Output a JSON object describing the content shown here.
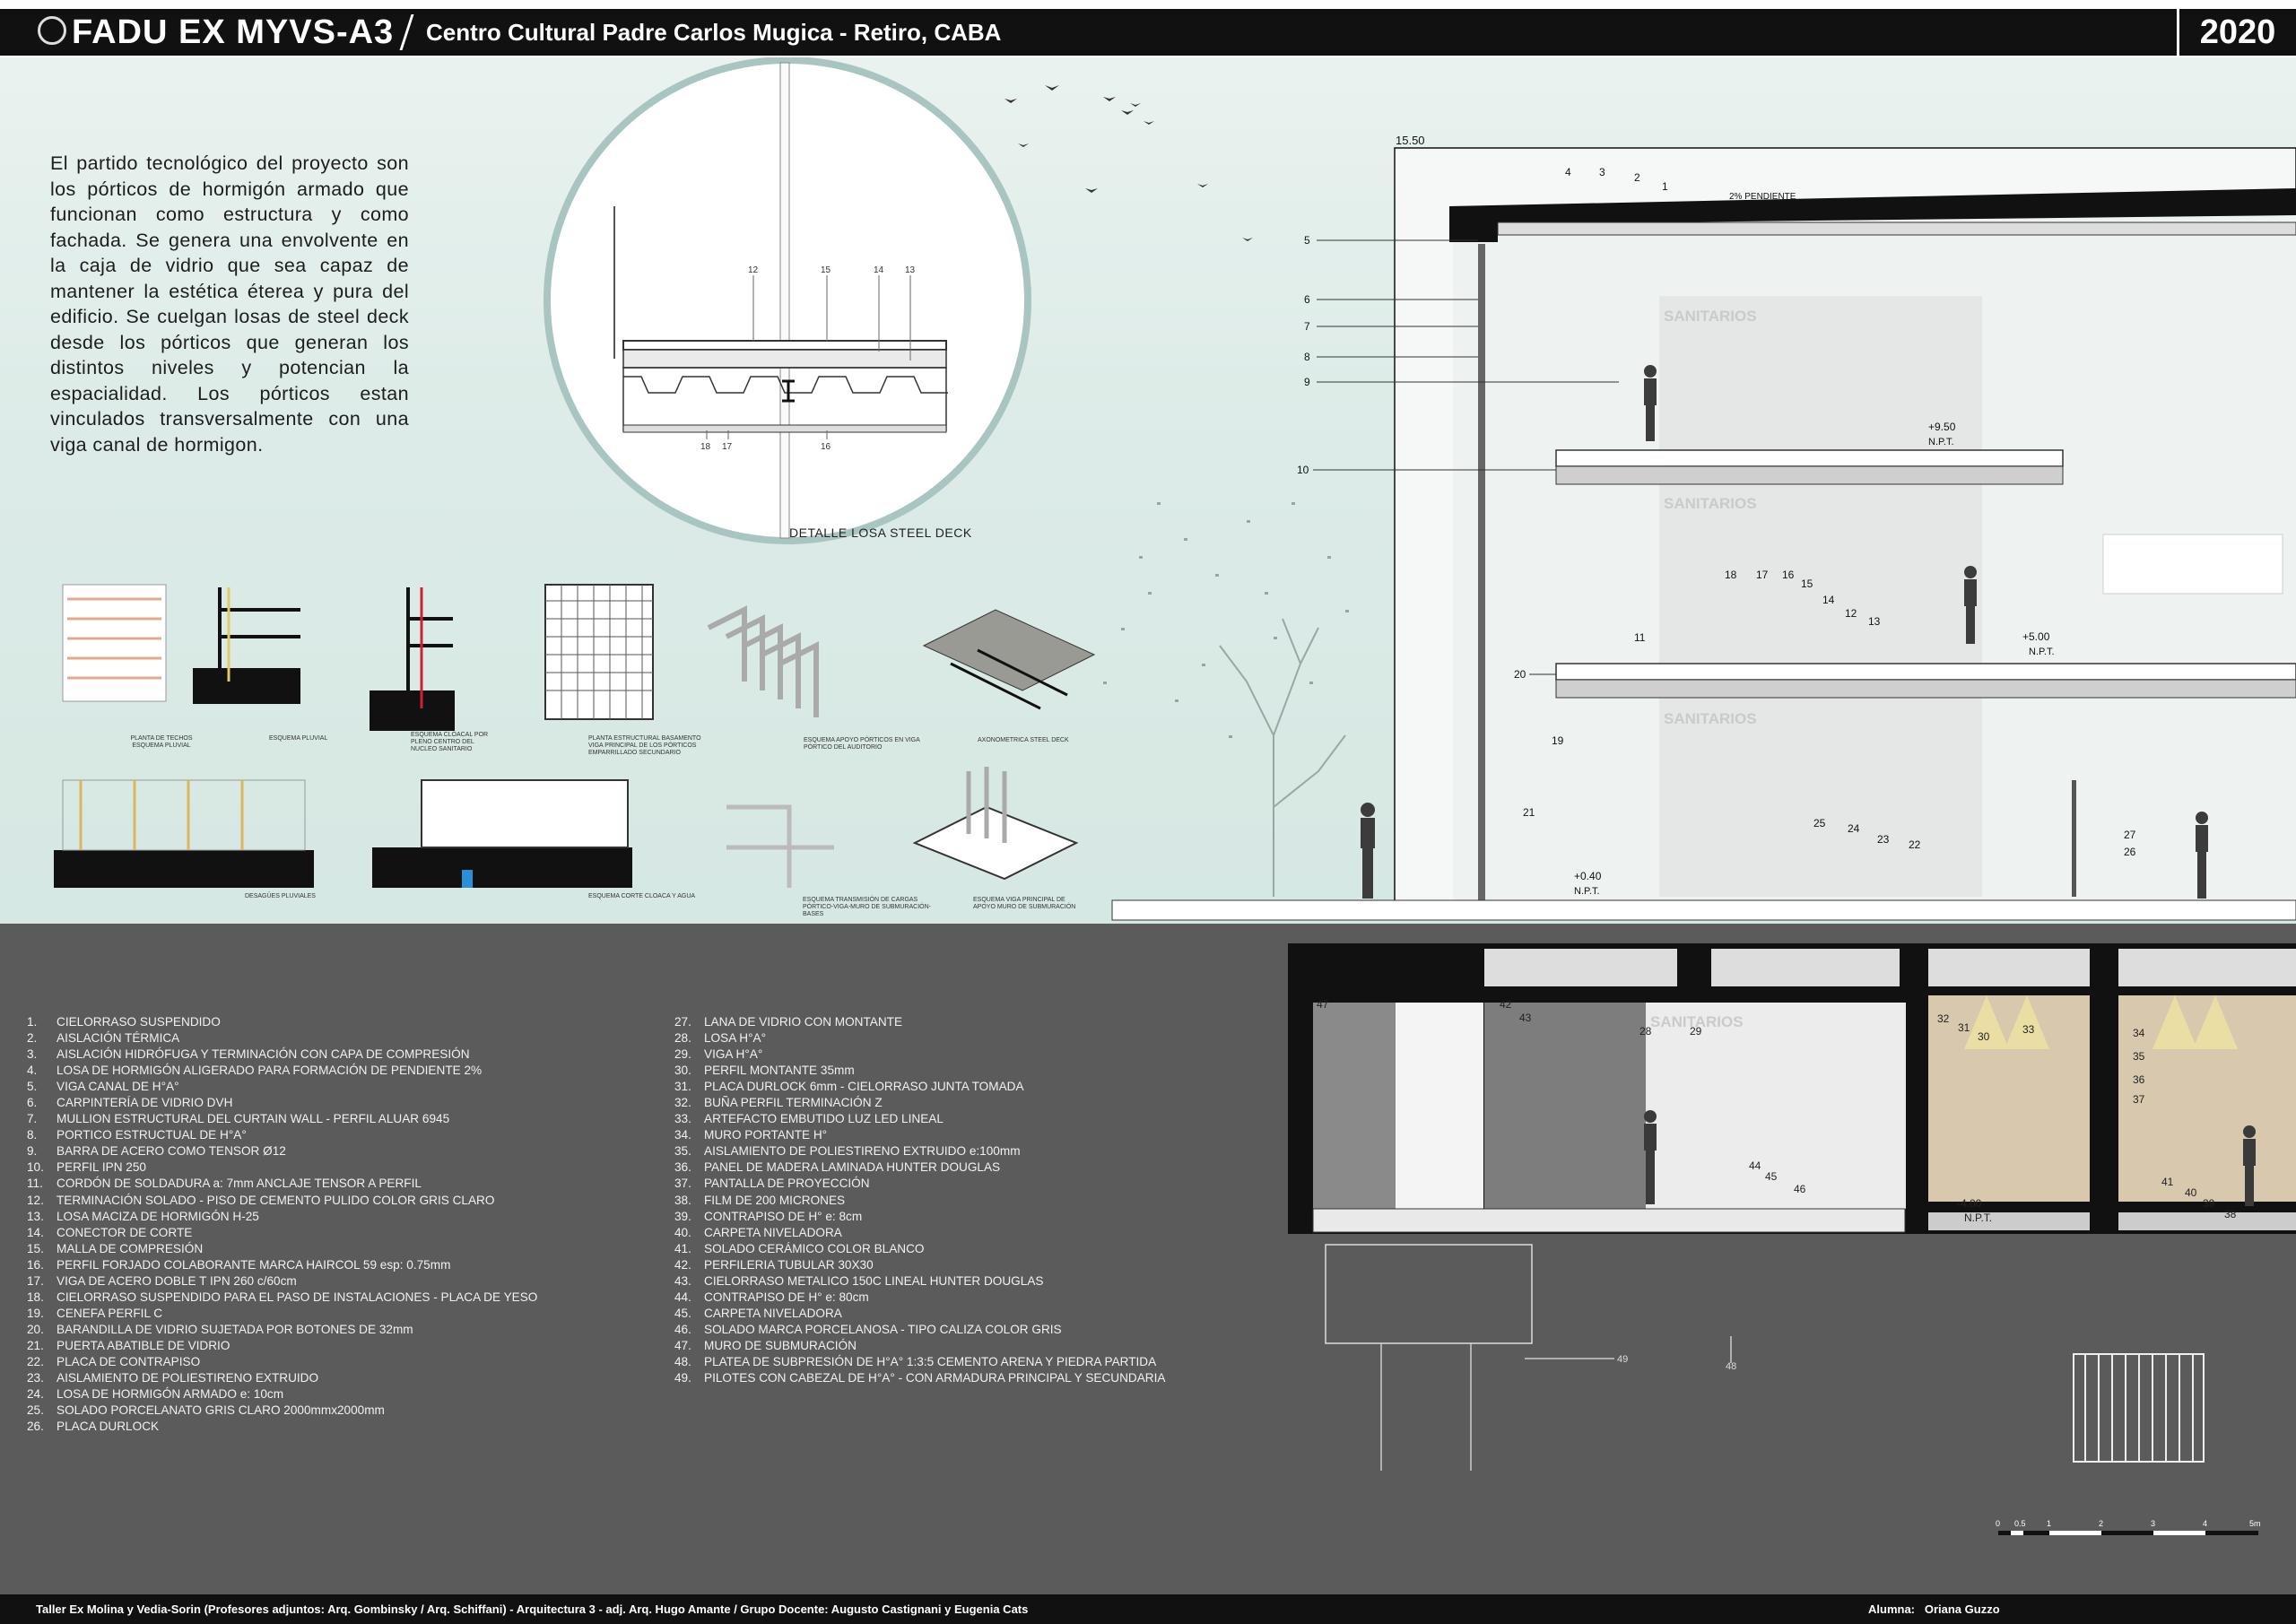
{
  "header": {
    "title": "FADU EX MYVS-A3",
    "subtitle": "Centro Cultural Padre Carlos Mugica  - Retiro, CABA",
    "year": "2020"
  },
  "intro_text": "El partido tecnológico del proyecto son los pórticos de hormigón armado que funcionan como estructura y como fachada. Se genera una envolvente en la caja de vidrio que sea capaz de mantener la estética éterea y pura del edificio. Se cuelgan losas de steel deck desde los pórticos que generan los distintos niveles y potencian la espacialidad. Los pórticos estan vinculados transversalmente con una viga canal de hormigon.",
  "detail": {
    "label": "DETALLE LOSA STEEL DECK",
    "callouts": [
      "12",
      "15",
      "14",
      "13",
      "18",
      "17",
      "16"
    ]
  },
  "thumbnails": [
    "PLANTA DE TECHOS ESQUEMA PLUVIAL",
    "ESQUEMA PLUVIAL",
    "ESQUEMA CLOACAL POR PLENO CENTRO DEL NUCLEO SANITARIO",
    "PLANTA ESTRUCTURAL BASAMENTO VIGA PRINCIPAL DE LOS PÓRTICOS EMPARRILLADO SECUNDARIO",
    "ESQUEMA APOYO PÓRTICOS EN VIGA PÓRTICO DEL AUDITORIO",
    "AXONOMETRICA STEEL DECK",
    "DESAGÜES PLUVIALES",
    "ESQUEMA CORTE CLOACA Y AGUA",
    "ESQUEMA TRANSMISIÓN DE CARGAS PÓRTICO-VIGA-MURO DE SUBMURACIÓN-BASES",
    "ESQUEMA VIGA PRINCIPAL DE APOYO MURO DE SUBMURACIÓN"
  ],
  "section": {
    "level_top": "15.50",
    "slope": "2% PENDIENTE",
    "level_1": "+9.50",
    "level_2": "+5.00",
    "level_3": "+0.40",
    "level_4": "-4.00",
    "npt": "N.P.T.",
    "room": "SANITARIOS",
    "callouts_left": [
      "5",
      "6",
      "7",
      "8",
      "9",
      "10",
      "20",
      "19",
      "21"
    ],
    "callouts_top": [
      "4",
      "3",
      "2",
      "1"
    ],
    "callouts_slab": [
      "18",
      "17",
      "16",
      "15",
      "14",
      "12",
      "13",
      "11"
    ],
    "callouts_ground": [
      "25",
      "24",
      "23",
      "22",
      "27",
      "26"
    ],
    "callouts_basement": [
      "47",
      "42",
      "43",
      "28",
      "29",
      "32",
      "31",
      "30",
      "33",
      "34",
      "35",
      "36",
      "37",
      "44",
      "45",
      "46",
      "41",
      "40",
      "39",
      "38",
      "49",
      "48"
    ]
  },
  "legend_left": [
    [
      "1.",
      "CIELORRASO SUSPENDIDO"
    ],
    [
      "2.",
      "AISLACIÓN TÉRMICA"
    ],
    [
      "3.",
      "AISLACIÓN HIDRÓFUGA Y TERMINACIÓN CON CAPA DE COMPRESIÓN"
    ],
    [
      "4.",
      "LOSA DE HORMIGÓN ALIGERADO PARA FORMACIÓN DE PENDIENTE 2%"
    ],
    [
      "5.",
      "VIGA CANAL DE H°A°"
    ],
    [
      "6.",
      "CARPINTERÍA DE VIDRIO DVH"
    ],
    [
      "7.",
      "MULLION ESTRUCTURAL DEL CURTAIN WALL - PERFIL ALUAR 6945"
    ],
    [
      "8.",
      "PORTICO ESTRUCTUAL DE H°A°"
    ],
    [
      "9.",
      "BARRA DE ACERO COMO TENSOR Ø12"
    ],
    [
      "10.",
      "PERFIL IPN 250"
    ],
    [
      "11.",
      "CORDÓN DE SOLDADURA a: 7mm ANCLAJE TENSOR A PERFIL"
    ],
    [
      "12.",
      "TERMINACIÓN SOLADO - PISO DE CEMENTO PULIDO COLOR GRIS CLARO"
    ],
    [
      "13.",
      "LOSA MACIZA DE HORMIGÓN H-25"
    ],
    [
      "14.",
      "CONECTOR DE CORTE"
    ],
    [
      "15.",
      "MALLA DE COMPRESIÓN"
    ],
    [
      "16.",
      "PERFIL FORJADO COLABORANTE MARCA HAIRCOL 59 esp: 0.75mm"
    ],
    [
      "17.",
      "VIGA DE ACERO DOBLE T IPN 260 c/60cm"
    ],
    [
      "18.",
      "CIELORRASO SUSPENDIDO  PARA EL PASO DE INSTALACIONES - PLACA DE YESO"
    ],
    [
      "19.",
      "CENEFA PERFIL C"
    ],
    [
      "20.",
      "BARANDILLA DE VIDRIO SUJETADA POR BOTONES DE 32mm"
    ],
    [
      "21.",
      "PUERTA ABATIBLE DE VIDRIO"
    ],
    [
      "22.",
      "PLACA DE CONTRAPISO"
    ],
    [
      "23.",
      "AISLAMIENTO DE POLIESTIRENO EXTRUIDO"
    ],
    [
      "24.",
      "LOSA DE HORMIGÓN ARMADO e: 10cm"
    ],
    [
      "25.",
      "SOLADO PORCELANATO GRIS CLARO 2000mmx2000mm"
    ],
    [
      "26.",
      "PLACA DURLOCK"
    ]
  ],
  "legend_right": [
    [
      "27.",
      "LANA DE VIDRIO CON MONTANTE"
    ],
    [
      "28.",
      "LOSA H°A°"
    ],
    [
      "29.",
      "VIGA H°A°"
    ],
    [
      "30.",
      "PERFIL MONTANTE 35mm"
    ],
    [
      "31.",
      "PLACA DURLOCK 6mm - CIELORRASO JUNTA TOMADA"
    ],
    [
      "32.",
      "BUÑA PERFIL TERMINACIÓN Z"
    ],
    [
      "33.",
      "ARTEFACTO EMBUTIDO LUZ LED LINEAL"
    ],
    [
      "34.",
      "MURO PORTANTE H°"
    ],
    [
      "35.",
      "AISLAMIENTO DE POLIESTIRENO EXTRUIDO e:100mm"
    ],
    [
      "36.",
      "PANEL DE MADERA LAMINADA HUNTER DOUGLAS"
    ],
    [
      "37.",
      "PANTALLA DE PROYECCIÓN"
    ],
    [
      "38.",
      "FILM DE 200 MICRONES"
    ],
    [
      "39.",
      "CONTRAPISO DE H° e: 8cm"
    ],
    [
      "40.",
      "CARPETA NIVELADORA"
    ],
    [
      "41.",
      "SOLADO CERÁMICO COLOR BLANCO"
    ],
    [
      "42.",
      "PERFILERIA TUBULAR 30X30"
    ],
    [
      "43.",
      "CIELORRASO METALICO 150C LINEAL HUNTER DOUGLAS"
    ],
    [
      "44.",
      "CONTRAPISO DE H° e: 80cm"
    ],
    [
      "45.",
      "CARPETA NIVELADORA"
    ],
    [
      "46.",
      "SOLADO MARCA PORCELANOSA - TIPO CALIZA COLOR GRIS"
    ],
    [
      "47.",
      "MURO DE SUBMURACIÓN"
    ],
    [
      "48.",
      "PLATEA DE SUBPRESIÓN DE H°A° 1:3:5 CEMENTO ARENA Y PIEDRA PARTIDA"
    ],
    [
      "49.",
      "PILOTES CON CABEZAL DE H°A° - CON ARMADURA PRINCIPAL Y SECUNDARIA"
    ]
  ],
  "scale_labels": [
    "0",
    "0.5",
    "1",
    "2",
    "3",
    "4",
    "5m"
  ],
  "footer": {
    "credits": "Taller Ex Molina y Vedia-Sorin (Profesores adjuntos:  Arq. Gombinsky / Arq. Schiffani) - Arquitectura 3 - adj. Arq. Hugo Amante / Grupo Docente:  Augusto Castignani y Eugenia Cats",
    "student_label": "Alumna:",
    "student_name": "Oriana Guzzo"
  }
}
